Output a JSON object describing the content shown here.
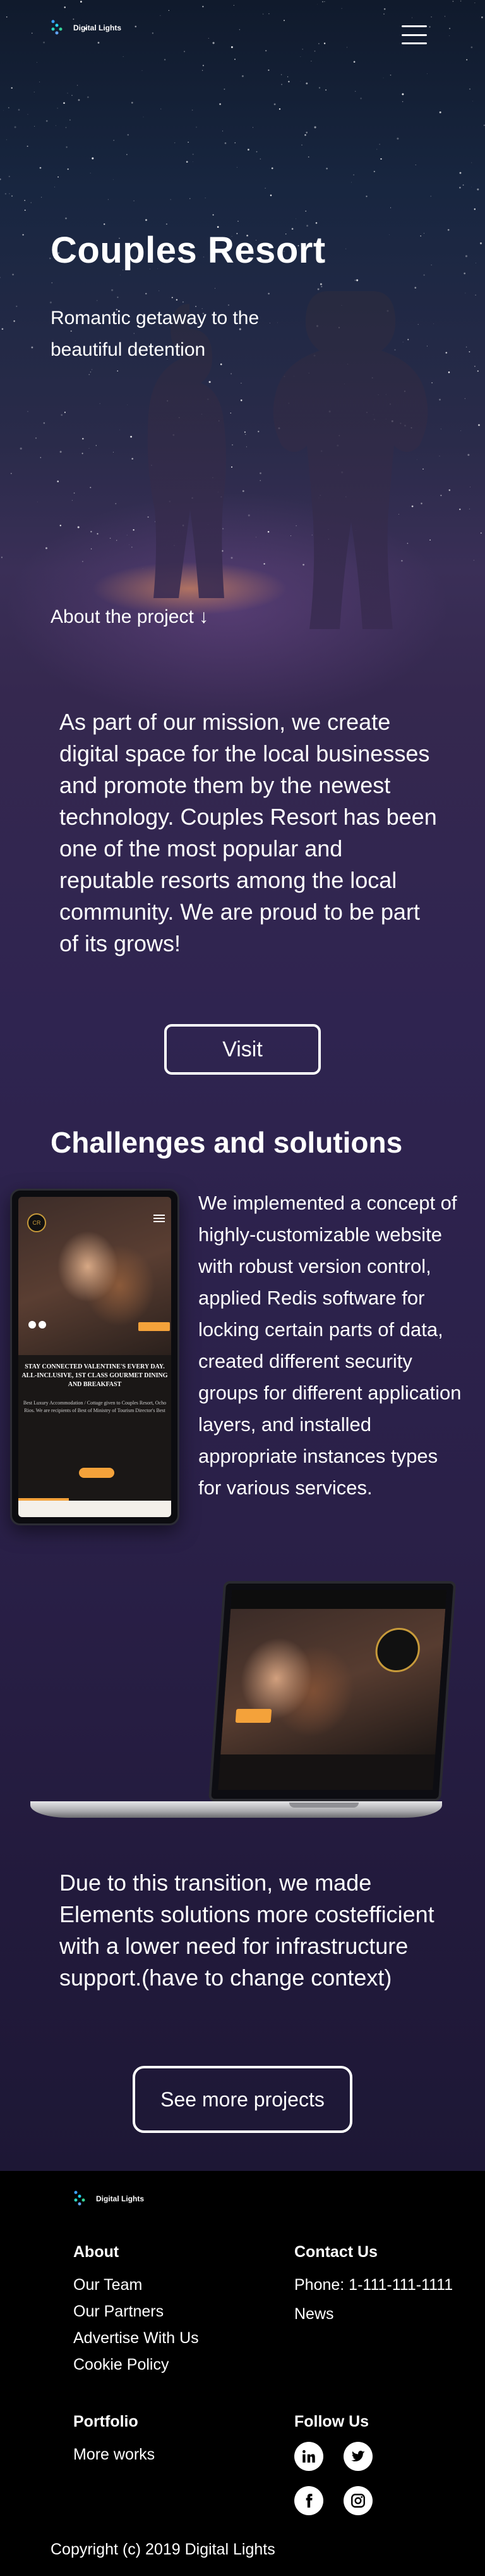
{
  "brand": {
    "name": "Digital Lights"
  },
  "hero": {
    "title": "Couples Resort",
    "subtitle": "Romantic getaway to the beautiful detention",
    "about_link": "About the project ↓"
  },
  "mission": {
    "text": "As part of our mission, we create digital space for the local businesses and promote them by the newest technology. Couples Resort has been one of the most popular and reputable resorts among the local community. We are proud to be part of its grows!",
    "visit_button": "Visit"
  },
  "challenges": {
    "title": "Challenges and solutions",
    "text": "We implemented a concept of highly-customizable website with robust version control, applied Redis software for locking certain parts of data, created different security groups for different application layers, and installed appropriate instances types for various services."
  },
  "mockup": {
    "phone_headline": "STAY CONNECTED VALENTINE'S EVERY DAY. ALL-INCLUSIVE, 1ST CLASS GOURMET DINING AND BREAKFAST",
    "phone_sub": "Best Luxury Accommodation / Cottage given to Couples Resort, Ocho Rios. We are recipients of Best of Ministry of Tourism Director's Best"
  },
  "transition": {
    "text": "Due to this transition, we made Elements solutions more costefficient with a lower need for infrastructure support.(have to change context)",
    "more_button": "See more projects"
  },
  "footer": {
    "about_title": "About",
    "about_links": [
      "Our Team",
      "Our Partners",
      "Advertise With Us",
      "Cookie Policy"
    ],
    "contact_title": "Contact Us",
    "contact_links": [
      "Phone: 1-111-111-1111",
      "News"
    ],
    "portfolio_title": "Portfolio",
    "portfolio_links": [
      "More works"
    ],
    "follow_title": "Follow Us",
    "social_icons": [
      "linkedin-icon",
      "twitter-icon",
      "facebook-icon",
      "instagram-icon"
    ],
    "copyright": "Copyright (c) 2019 Digital Lights"
  },
  "colors": {
    "accent_orange": "#f4a23a",
    "footer_bg": "#000000",
    "text": "#ffffff"
  }
}
